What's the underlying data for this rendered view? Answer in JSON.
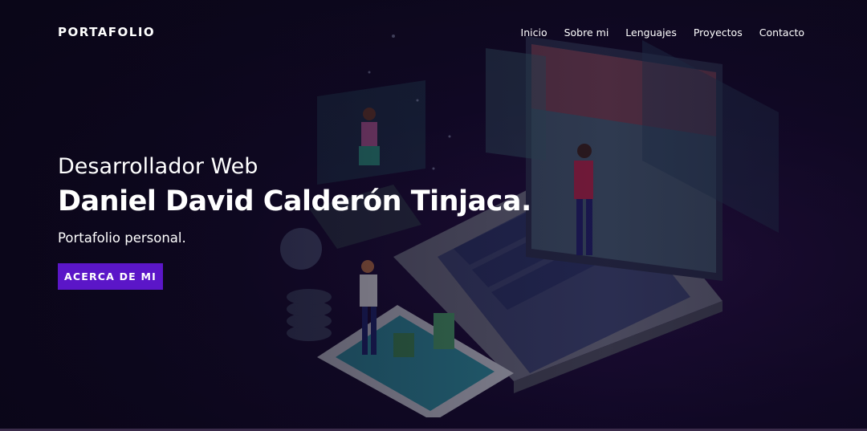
{
  "brand": {
    "name": "PORTAFOLIO"
  },
  "nav": {
    "items": [
      {
        "label": "Inicio"
      },
      {
        "label": "Sobre mi"
      },
      {
        "label": "Lenguajes"
      },
      {
        "label": "Proyectos"
      },
      {
        "label": "Contacto"
      }
    ]
  },
  "hero": {
    "subtitle": "Desarrollador Web",
    "name": "Daniel David Calderón Tinjaca",
    "name_suffix": ".",
    "tagline": "Portafolio personal.",
    "cta_label": "ACERCA DE MI",
    "illustration": "isometric-developer-laptop-illustration"
  },
  "colors": {
    "background": "#0b0718",
    "accent": "#5b16c8",
    "text": "#ffffff"
  }
}
